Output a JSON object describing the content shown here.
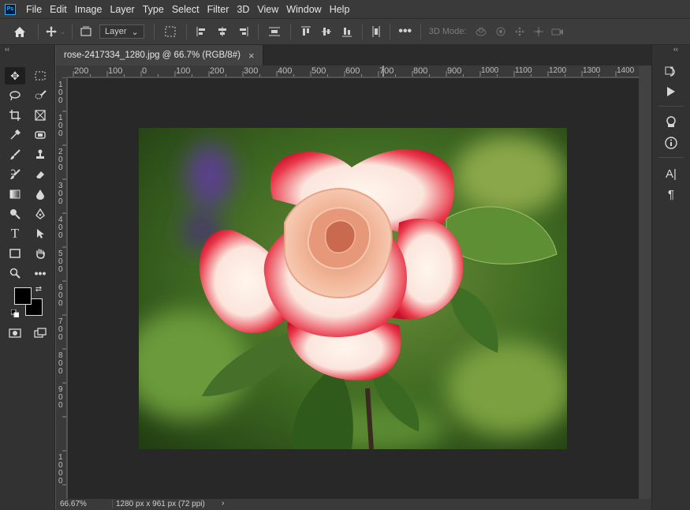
{
  "menu": [
    "File",
    "Edit",
    "Image",
    "Layer",
    "Type",
    "Select",
    "Filter",
    "3D",
    "View",
    "Window",
    "Help"
  ],
  "app_logo": "Ps",
  "options_bar": {
    "auto_select_target": "Layer",
    "mode_label": "3D Mode:"
  },
  "document_tab": {
    "title": "rose-2417334_1280.jpg @ 66.7% (RGB/8#)",
    "close": "×"
  },
  "ruler_top": [
    "200",
    "100",
    "0",
    "100",
    "200",
    "300",
    "400",
    "500",
    "600",
    "700",
    "800",
    "900",
    "1000",
    "1100",
    "1200",
    "1300",
    "1400"
  ],
  "ruler_left": [
    "1",
    "0",
    "0",
    "1",
    "0",
    "0",
    "2",
    "0",
    "0",
    "3",
    "0",
    "0",
    "4",
    "0",
    "0",
    "5",
    "0",
    "0",
    "6",
    "0",
    "0",
    "7",
    "0",
    "0",
    "8",
    "0",
    "0",
    "9",
    "0",
    "0",
    "1",
    "0",
    "0",
    "0"
  ],
  "status": {
    "zoom": "66.67%",
    "info": "1280 px x 961 px (72 ppi)",
    "arrow": "›"
  },
  "colors": {
    "foreground": "#000000",
    "background": "#000000",
    "accent": "#31a8ff"
  },
  "icons": {
    "tools": [
      "move-icon",
      "marquee-icon",
      "lasso-icon",
      "quick-select-icon",
      "crop-icon",
      "frame-icon",
      "eyedropper-icon",
      "patch-icon",
      "brush-icon",
      "stamp-icon",
      "history-brush-icon",
      "eraser-icon",
      "gradient-icon",
      "blur-icon",
      "dodge-icon",
      "pen-icon",
      "type-icon",
      "path-select-icon",
      "rectangle-icon",
      "hand-icon",
      "zoom-icon",
      "more-icon"
    ],
    "right_panel": [
      "history-icon",
      "play-icon",
      "libraries-icon",
      "info-icon",
      "character-icon",
      "paragraph-icon"
    ]
  }
}
